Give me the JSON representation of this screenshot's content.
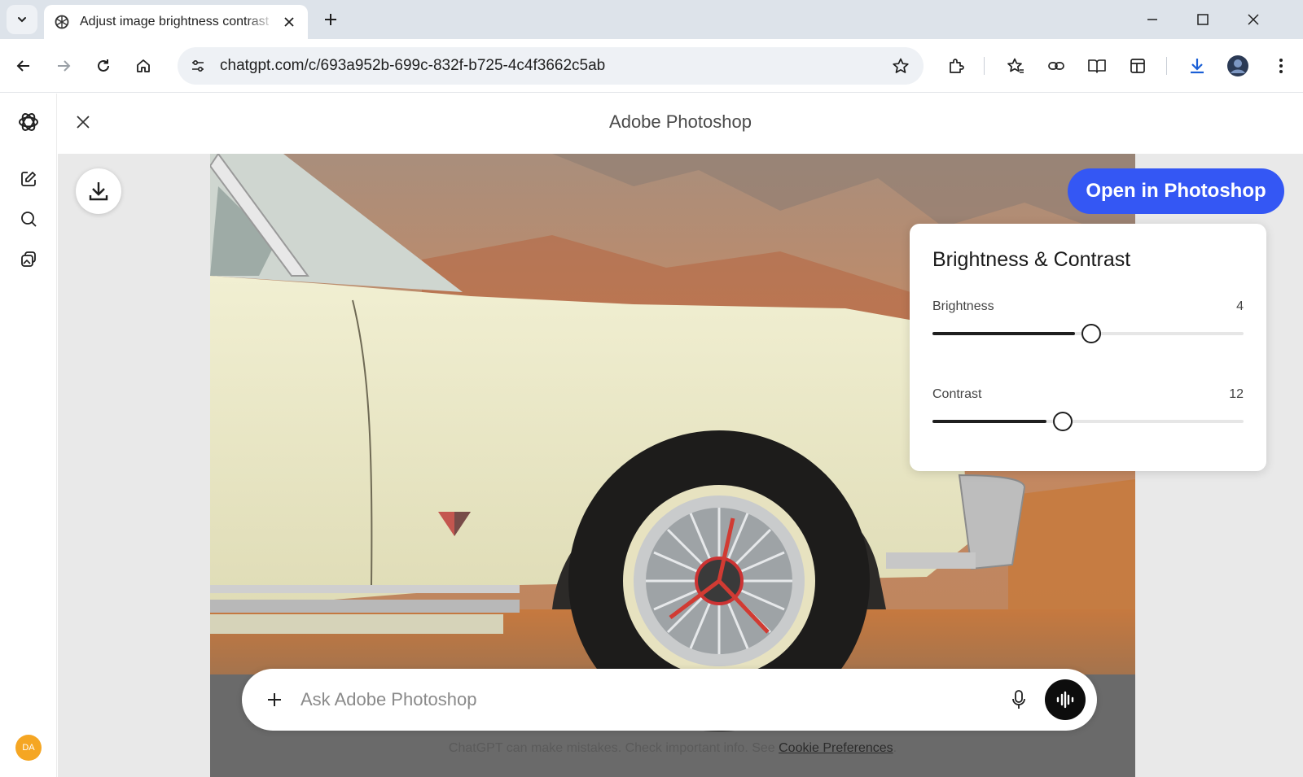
{
  "browser": {
    "tab_title": "Adjust image brightness contrast",
    "url": "chatgpt.com/c/693a952b-699c-832f-b725-4c4f3662c5ab"
  },
  "sidebar": {
    "avatar_initials": "DA",
    "items": [
      {
        "icon": "new-chat-icon"
      },
      {
        "icon": "search-icon"
      },
      {
        "icon": "library-icon"
      }
    ]
  },
  "app": {
    "title": "Adobe Photoshop",
    "open_button": "Open in Photoshop"
  },
  "adjustments": {
    "title": "Brightness & Contrast",
    "brightness": {
      "label": "Brightness",
      "value": "4",
      "fraction": 0.51
    },
    "contrast": {
      "label": "Contrast",
      "value": "12",
      "fraction": 0.42
    }
  },
  "chat": {
    "placeholder": "Ask Adobe Photoshop",
    "disclaimer_text": "ChatGPT can make mistakes. Check important info. See ",
    "disclaimer_link": "Cookie Preferences",
    "disclaimer_end": "."
  },
  "colors": {
    "accent": "#3457f4",
    "avatar": "#f5a623"
  }
}
